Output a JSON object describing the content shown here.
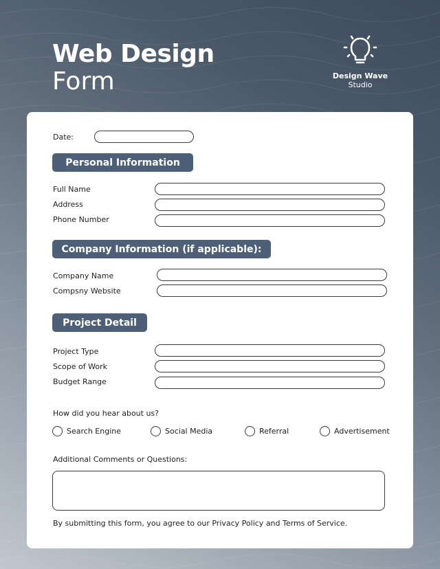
{
  "header": {
    "title_bold": "Web Design",
    "title_light": "Form"
  },
  "logo": {
    "icon": "lightbulb-icon",
    "brand": "Design Wave",
    "sub": "Studio"
  },
  "colors": {
    "section_bg": "#4d6078",
    "background_dark": "#3e4b5c",
    "background_light": "#c1c7ce"
  },
  "form": {
    "date_label": "Date:",
    "date_value": "",
    "personal": {
      "heading": "Personal Information",
      "fields": [
        {
          "label": "Full Name",
          "value": ""
        },
        {
          "label": "Address",
          "value": ""
        },
        {
          "label": "Phone Number",
          "value": ""
        }
      ]
    },
    "company": {
      "heading": "Company Information (if applicable):",
      "fields": [
        {
          "label": "Company Name",
          "value": ""
        },
        {
          "label": "Compsny Website",
          "value": ""
        }
      ]
    },
    "project": {
      "heading": "Project Detail",
      "fields": [
        {
          "label": "Project Type",
          "value": ""
        },
        {
          "label": "Scope of Work",
          "value": ""
        },
        {
          "label": "Budget Range",
          "value": ""
        }
      ]
    },
    "source": {
      "question": "How did you hear about us?",
      "options": [
        "Search Engine",
        "Social Media",
        "Referral",
        "Advertisement"
      ],
      "selected": null
    },
    "comments": {
      "label": "Additional Comments or Questions:",
      "value": ""
    },
    "disclaimer": "By submitting this form, you agree to our Privacy Policy and Terms of Service."
  }
}
